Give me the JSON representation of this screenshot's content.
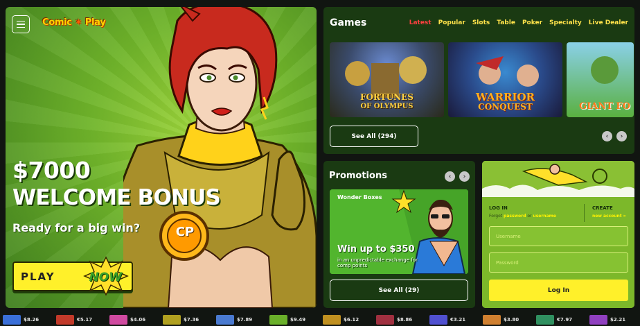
{
  "brand": {
    "name": "Comic Play",
    "part1": "Comic",
    "part2": "Play"
  },
  "hero": {
    "amount": "$7000",
    "bonus": "WELCOME BONUS",
    "subtitle": "Ready for a big win?",
    "play_label": "PLAY",
    "now_label": "NOW",
    "badge": "CP"
  },
  "games": {
    "title": "Games",
    "tabs": [
      {
        "label": "Latest",
        "active": true
      },
      {
        "label": "Popular"
      },
      {
        "label": "Slots"
      },
      {
        "label": "Table"
      },
      {
        "label": "Poker"
      },
      {
        "label": "Specialty"
      },
      {
        "label": "Live Dealer"
      }
    ],
    "items": [
      {
        "title_line1": "FORTUNES",
        "title_line2": "OF OLYMPUS"
      },
      {
        "title_line1": "WARRIOR",
        "title_line2": "CONQUEST"
      },
      {
        "title_line1": "GIANT FO",
        "title_line2": ""
      }
    ],
    "see_all_label": "See All (294)"
  },
  "promotions": {
    "title": "Promotions",
    "card_name": "Wonder Boxes",
    "card_headline": "Win up to $350",
    "card_desc": "in an unpredictable exchange for comp points",
    "see_all_label": "See All (29)"
  },
  "login": {
    "login_label": "LOG IN",
    "forgot_prefix": "Forgot",
    "forgot_password": "password",
    "forgot_or": "or",
    "forgot_username": "username",
    "create_label": "CREATE",
    "new_account_label": "new account »",
    "username_placeholder": "Username",
    "password_placeholder": "Password",
    "submit_label": "Log In"
  },
  "ticker": [
    {
      "value": "$8.26",
      "color": "#3a6fd8"
    },
    {
      "value": "€5.17",
      "color": "#c23a2a"
    },
    {
      "value": "$4.06",
      "color": "#d04aa0"
    },
    {
      "value": "$7.36",
      "color": "#b0a020"
    },
    {
      "value": "$7.89",
      "color": "#4a7ad0"
    },
    {
      "value": "$9.49",
      "color": "#6ab02a"
    },
    {
      "value": "$6.12",
      "color": "#c09020"
    },
    {
      "value": "$8.86",
      "color": "#a03040"
    },
    {
      "value": "€3.21",
      "color": "#5050d0"
    },
    {
      "value": "$3.80",
      "color": "#d08030"
    },
    {
      "value": "€7.97",
      "color": "#309060"
    },
    {
      "value": "$2.21",
      "color": "#9040c0"
    }
  ]
}
